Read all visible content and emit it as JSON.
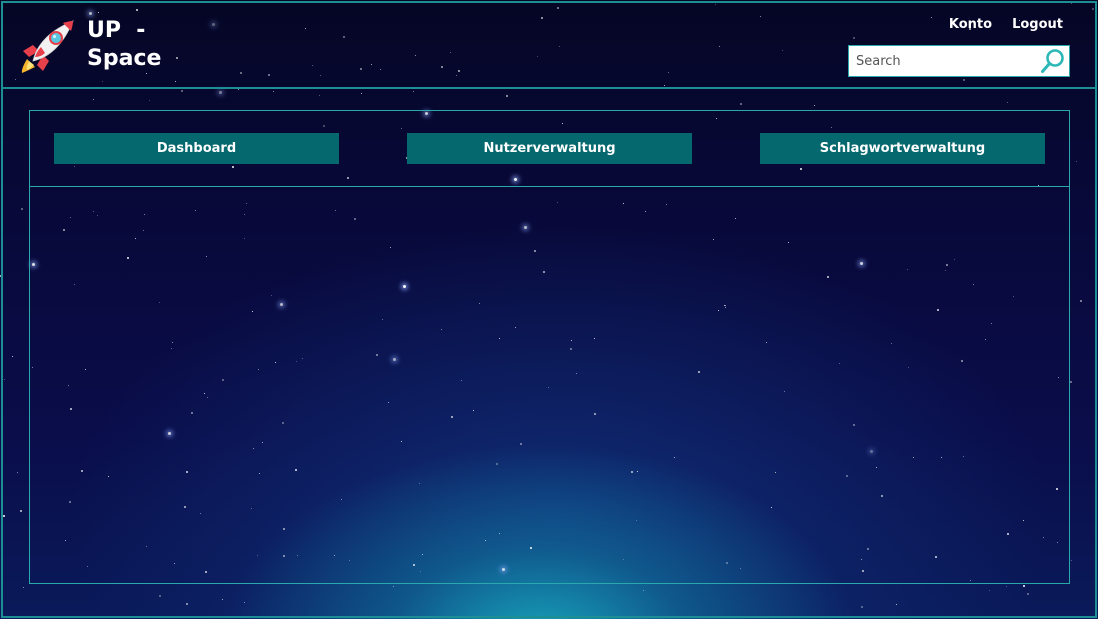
{
  "header": {
    "brand_line1": "UP  -",
    "brand_line2": "Space",
    "logo_icon": "rocket-icon",
    "nav": [
      {
        "label": "Konto"
      },
      {
        "label": "Logout"
      }
    ],
    "search": {
      "placeholder": "Search",
      "value": "",
      "icon": "search-icon"
    }
  },
  "main": {
    "tabs": [
      {
        "label": "Dashboard"
      },
      {
        "label": "Nutzerverwaltung"
      },
      {
        "label": "Schlagwortverwaltung"
      }
    ]
  },
  "colors": {
    "accent": "#1d8e93",
    "tab_bg": "#05686e",
    "background": "#08093a"
  }
}
